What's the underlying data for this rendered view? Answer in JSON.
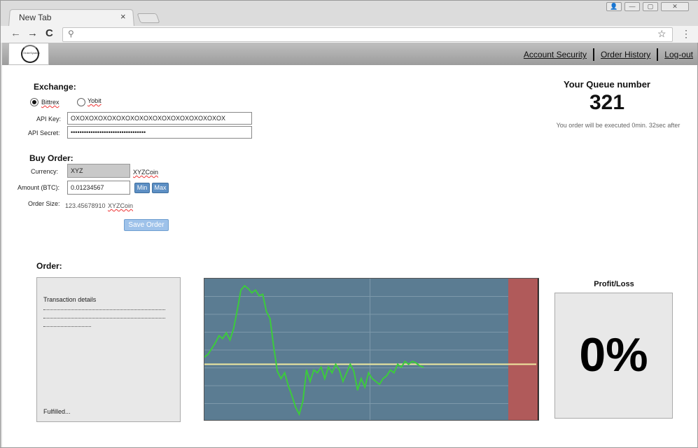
{
  "browser": {
    "tab_title": "New Tab",
    "tab_close": "×",
    "nav_back": "←",
    "nav_forward": "→",
    "nav_reload": "C",
    "address_value": "",
    "bookmark_star": "☆",
    "menu": "⋮",
    "win_minimize": "—",
    "win_maximize": "▢",
    "win_close": "✕"
  },
  "header": {
    "logo_text": "OrderSystem",
    "links": [
      "Account Security",
      "Order History",
      "Log-out"
    ]
  },
  "exchange": {
    "heading": "Exchange:",
    "options": [
      "Bittrex",
      "Yobit"
    ],
    "selected": "Bittrex",
    "api_key_label": "API Key:",
    "api_key_value": "OXOXOXOXOXOXOXOXOXOXOXOXOXOXOXOXOX",
    "api_secret_label": "API Secret:",
    "api_secret_value": "••••••••••••••••••••••••••••••••••"
  },
  "buy_order": {
    "heading": "Buy Order:",
    "currency_label": "Currency:",
    "currency_value": "XYZ",
    "currency_name": "XYZCoin",
    "amount_label": "Amount (BTC):",
    "amount_value": "0.01234567",
    "min_label": "Min",
    "max_label": "Max",
    "order_size_label": "Order Size:",
    "order_size_value": "123.45678910",
    "order_size_unit": "XYZCoin",
    "save_label": "Save Order"
  },
  "queue": {
    "title": "Your Queue number",
    "number": "321",
    "note": "You order will be executed 0min. 32sec after"
  },
  "order": {
    "heading": "Order:",
    "details_title": "Transaction details",
    "status": "Fulfilled..."
  },
  "profit_loss": {
    "title": "Profit/Loss",
    "value": "0%"
  },
  "chart_data": {
    "type": "line",
    "x": [
      0,
      1,
      2,
      3,
      4,
      5,
      6,
      7,
      8,
      9,
      10,
      11,
      12,
      13,
      14,
      15,
      16,
      17,
      18,
      19,
      20,
      21,
      22,
      23,
      24,
      25,
      26,
      27,
      28,
      29,
      30,
      31,
      32,
      33,
      34,
      35,
      36,
      37,
      38,
      39,
      40,
      41,
      42,
      43,
      44,
      45,
      46,
      47,
      48,
      49,
      50,
      51,
      52,
      53,
      54,
      55,
      56,
      57,
      58,
      59,
      60
    ],
    "series": [
      {
        "values": [
          0.45,
          0.47,
          0.51,
          0.55,
          0.6,
          0.58,
          0.62,
          0.57,
          0.65,
          0.78,
          0.92,
          0.95,
          0.93,
          0.9,
          0.92,
          0.88,
          0.89,
          0.77,
          0.72,
          0.52,
          0.35,
          0.3,
          0.34,
          0.25,
          0.18,
          0.1,
          0.05,
          0.14,
          0.36,
          0.28,
          0.36,
          0.34,
          0.38,
          0.3,
          0.38,
          0.34,
          0.4,
          0.36,
          0.28,
          0.34,
          0.4,
          0.35,
          0.22,
          0.3,
          0.24,
          0.34,
          0.3,
          0.28,
          0.26,
          0.3,
          0.32,
          0.36,
          0.34,
          0.4,
          0.38,
          0.42,
          0.4,
          0.42,
          0.41,
          0.39,
          0.38
        ],
        "color": "#3ccb3c"
      }
    ],
    "baseline": 0.4,
    "ylim": [
      0,
      1
    ],
    "grid": true,
    "background": "#5b7c92",
    "baseline_color": "#efe9a0",
    "future_zone_color": "#b05a5a"
  }
}
